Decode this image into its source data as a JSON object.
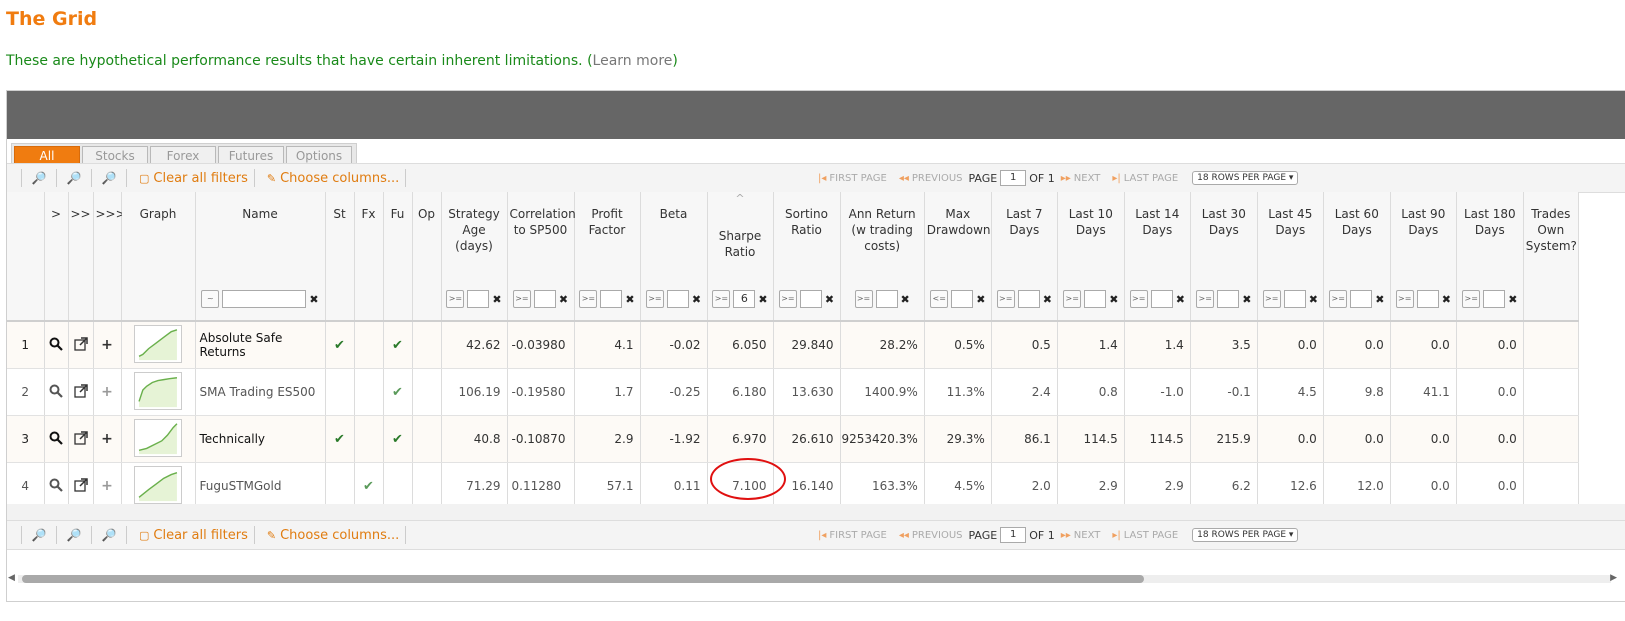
{
  "title": "The Grid",
  "disclaimer": {
    "text": "These are hypothetical performance results that have certain inherent limitations. (",
    "link": "Learn more",
    "close": ")"
  },
  "tabs": [
    "All",
    "Stocks",
    "Forex",
    "Futures",
    "Options"
  ],
  "toolbar": {
    "clear_filters": "Clear all filters",
    "choose_columns": "Choose columns...",
    "first_page": "FIRST PAGE",
    "previous": "PREVIOUS",
    "page_label": "PAGE",
    "page_value": "1",
    "of_label": "OF 1",
    "next": "NEXT",
    "last_page": "LAST PAGE",
    "rows_per_page": "18 ROWS PER PAGE"
  },
  "columns": [
    {
      "label": "",
      "filter": null
    },
    {
      "label": ">",
      "filter": null
    },
    {
      "label": ">>",
      "filter": null
    },
    {
      "label": ">>>",
      "filter": null
    },
    {
      "label": "Graph",
      "filter": null
    },
    {
      "label": "Name",
      "filter": {
        "op": "~",
        "value": ""
      }
    },
    {
      "label": "St",
      "filter": null
    },
    {
      "label": "Fx",
      "filter": null
    },
    {
      "label": "Fu",
      "filter": null
    },
    {
      "label": "Op",
      "filter": null
    },
    {
      "label": "Strategy Age (days)",
      "filter": {
        "op": ">=",
        "value": ""
      }
    },
    {
      "label": "Correlation to SP500",
      "filter": {
        "op": ">=",
        "value": ""
      }
    },
    {
      "label": "Profit Factor",
      "filter": {
        "op": ">=",
        "value": ""
      }
    },
    {
      "label": "Beta",
      "filter": {
        "op": ">=",
        "value": ""
      }
    },
    {
      "label": "Sharpe Ratio",
      "filter": {
        "op": ">=",
        "value": "6"
      },
      "sorted": "^"
    },
    {
      "label": "Sortino Ratio",
      "filter": {
        "op": ">=",
        "value": ""
      }
    },
    {
      "label": "Ann Return (w trading costs)",
      "filter": {
        "op": ">=",
        "value": ""
      }
    },
    {
      "label": "Max Drawdown",
      "filter": {
        "op": "<=",
        "value": ""
      }
    },
    {
      "label": "Last 7 Days",
      "filter": {
        "op": ">=",
        "value": ""
      }
    },
    {
      "label": "Last 10 Days",
      "filter": {
        "op": ">=",
        "value": ""
      }
    },
    {
      "label": "Last 14 Days",
      "filter": {
        "op": ">=",
        "value": ""
      }
    },
    {
      "label": "Last 30 Days",
      "filter": {
        "op": ">=",
        "value": ""
      }
    },
    {
      "label": "Last 45 Days",
      "filter": {
        "op": ">=",
        "value": ""
      }
    },
    {
      "label": "Last 60 Days",
      "filter": {
        "op": ">=",
        "value": ""
      }
    },
    {
      "label": "Last 90 Days",
      "filter": {
        "op": ">=",
        "value": ""
      }
    },
    {
      "label": "Last 180 Days",
      "filter": {
        "op": ">=",
        "value": ""
      }
    },
    {
      "label": "Trades Own System?",
      "filter": null
    }
  ],
  "rows": [
    {
      "n": "1",
      "name": "Absolute Safe Returns",
      "st": true,
      "fx": false,
      "fu": true,
      "op": false,
      "age": "42.62",
      "corr": "-0.03980",
      "pf": "4.1",
      "beta": "-0.02",
      "sharpe": "6.050",
      "sortino": "29.840",
      "ann": "28.2%",
      "dd": "0.5%",
      "l7": "0.5",
      "l10": "1.4",
      "l14": "1.4",
      "l30": "3.5",
      "l45": "0.0",
      "l60": "0.0",
      "l90": "0.0",
      "l180": "0.0",
      "bold": true
    },
    {
      "n": "2",
      "name": "SMA Trading ES500",
      "st": false,
      "fx": false,
      "fu": true,
      "op": false,
      "age": "106.19",
      "corr": "-0.19580",
      "pf": "1.7",
      "beta": "-0.25",
      "sharpe": "6.180",
      "sortino": "13.630",
      "ann": "1400.9%",
      "dd": "11.3%",
      "l7": "2.4",
      "l10": "0.8",
      "l14": "-1.0",
      "l30": "-0.1",
      "l45": "4.5",
      "l60": "9.8",
      "l90": "41.1",
      "l180": "0.0",
      "bold": false
    },
    {
      "n": "3",
      "name": "Technically",
      "st": true,
      "fx": false,
      "fu": true,
      "op": false,
      "age": "40.8",
      "corr": "-0.10870",
      "pf": "2.9",
      "beta": "-1.92",
      "sharpe": "6.970",
      "sortino": "26.610",
      "ann": "9253420.3%",
      "dd": "29.3%",
      "l7": "86.1",
      "l10": "114.5",
      "l14": "114.5",
      "l30": "215.9",
      "l45": "0.0",
      "l60": "0.0",
      "l90": "0.0",
      "l180": "0.0",
      "bold": true
    },
    {
      "n": "4",
      "name": "FuguSTMGold",
      "st": false,
      "fx": true,
      "fu": false,
      "op": false,
      "age": "71.29",
      "corr": "0.11280",
      "pf": "57.1",
      "beta": "0.11",
      "sharpe": "7.100",
      "sortino": "16.140",
      "ann": "163.3%",
      "dd": "4.5%",
      "l7": "2.0",
      "l10": "2.9",
      "l14": "2.9",
      "l30": "6.2",
      "l45": "12.6",
      "l60": "12.0",
      "l90": "0.0",
      "l180": "0.0",
      "bold": false
    }
  ],
  "colors": {
    "accent": "#f07c10",
    "disclaimer": "#1a8a1a",
    "highlight": "#e01010"
  }
}
